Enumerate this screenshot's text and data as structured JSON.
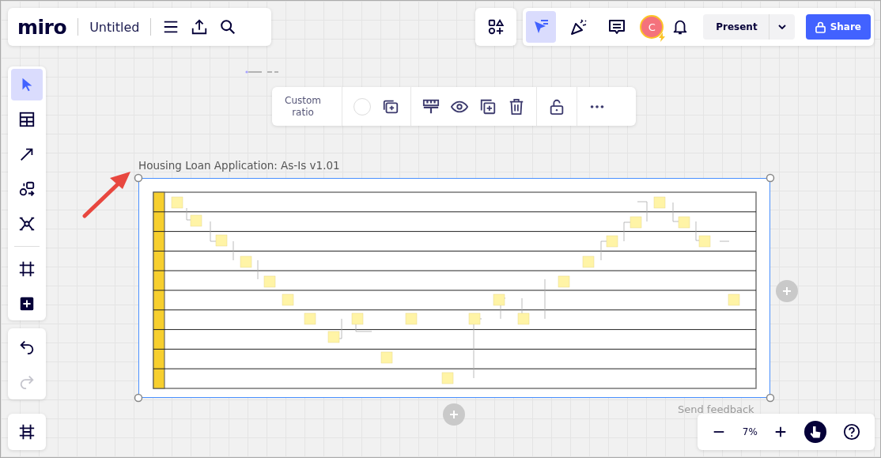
{
  "header": {
    "logo": "miro",
    "board_title": "Untitled"
  },
  "top_bar": {
    "tools": [
      {
        "kind": "select",
        "selected": true
      },
      {
        "kind": "celebrate",
        "selected": false
      },
      {
        "kind": "comment",
        "selected": false
      }
    ],
    "avatar": {
      "initial": "C"
    },
    "present": "Present",
    "share": "Share"
  },
  "left_toolbar": {
    "tools": [
      {
        "kind": "select",
        "selected": true
      },
      {
        "kind": "table",
        "selected": false
      },
      {
        "kind": "arrow",
        "selected": false
      },
      {
        "kind": "shapes",
        "selected": false
      },
      {
        "kind": "mindmap",
        "selected": false
      },
      {
        "kind": "frame",
        "selected": false
      },
      {
        "kind": "add",
        "selected": false
      }
    ],
    "history": [
      {
        "kind": "undo",
        "disabled": false
      },
      {
        "kind": "redo",
        "disabled": true
      }
    ]
  },
  "context_toolbar": {
    "ratio": "Custom ratio"
  },
  "frame": {
    "title": "Housing Loan Application: As-Is v1.01"
  },
  "feedback": "Send feedback",
  "zoom": {
    "value": "7%"
  }
}
